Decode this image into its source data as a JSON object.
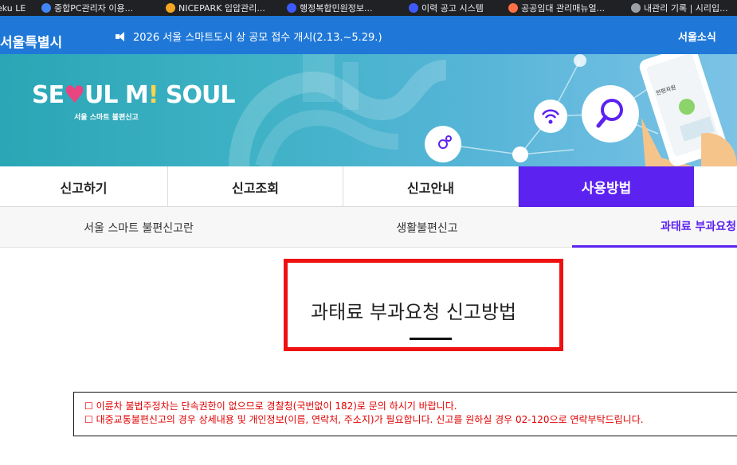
{
  "bookmarks": [
    {
      "label": "eku LE",
      "color": "#9aa0a6"
    },
    {
      "label": "중합PC관리자 이용...",
      "color": "#4285f4"
    },
    {
      "label": "NICEPARK 입압관리...",
      "color": "#f5a623"
    },
    {
      "label": "행정복합민원정보...",
      "color": "#3d5afe"
    },
    {
      "label": "이력 공고 시스템",
      "color": "#3d5afe"
    },
    {
      "label": "공공임대 관리매뉴얼...",
      "color": "#ff7043"
    },
    {
      "label": "내관리 기록 | 시리입...",
      "color": "#9aa0a6"
    }
  ],
  "topbar": {
    "brand": "서울특별시",
    "notice": "2026 서울 스마트도시 상 공모 접수 개시(2.13.~5.29.)",
    "news": "서울소식"
  },
  "hero": {
    "logo_parts": [
      "SE",
      "♥",
      "UL M",
      "!",
      " SOUL"
    ],
    "subtitle": "서울 스마트 불편신고",
    "phone_text": "한편자원"
  },
  "main_tabs": [
    {
      "label": "신고하기",
      "active": false
    },
    {
      "label": "신고조회",
      "active": false
    },
    {
      "label": "신고안내",
      "active": false
    },
    {
      "label": "사용방법",
      "active": true
    }
  ],
  "sub_tabs": [
    {
      "label": "서울 스마트 불편신고란",
      "active": false
    },
    {
      "label": "생활불편신고",
      "active": false
    },
    {
      "label": "과태료 부과요청",
      "active": true
    }
  ],
  "content": {
    "title": "과태료 부과요청 신고방법"
  },
  "notices": [
    "☐ 이륜차 불법주정차는 단속권한이 없으므로 경찰청(국번없이 182)로 문의 하시기 바랍니다.",
    "☐ 대중교통불편신고의 경우 상세내용 및 개인정보(이름, 연락처, 주소지)가 필요합니다. 신고를 원하실 경우 02-120으로 연락부탁드립니다."
  ],
  "colors": {
    "accent": "#5c22f0",
    "topbar": "#1f78d8",
    "highlight_box": "#ee1111",
    "notice_text": "#e00000"
  }
}
